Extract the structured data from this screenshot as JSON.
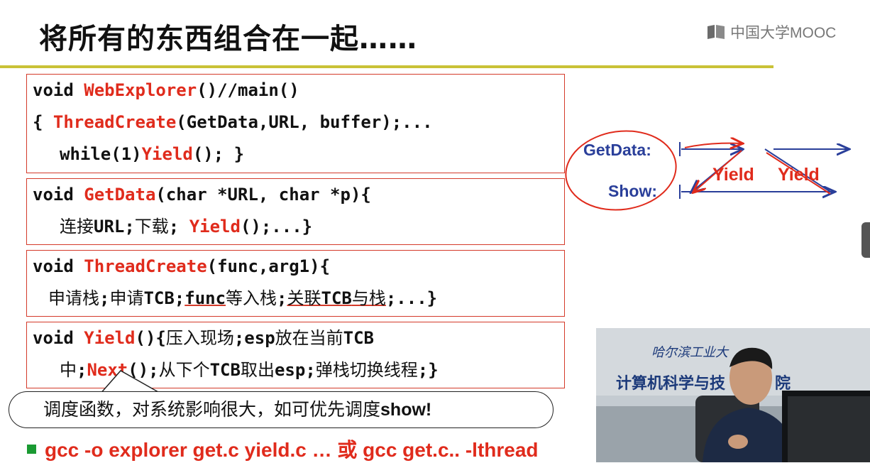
{
  "title": "将所有的东西组合在一起……",
  "mooc_logo": {
    "text": "中国大学MOOC",
    "icon": "book-icon"
  },
  "code": {
    "box1": {
      "l1_a": "void ",
      "l1_b": "WebExplorer",
      "l1_c": "()//main()",
      "l2_a": "{ ",
      "l2_b": "ThreadCreate",
      "l2_c": "(GetData,URL, buffer);...",
      "l3_a": "while(1)",
      "l3_b": "Yield",
      "l3_c": "(); }"
    },
    "box2": {
      "l1_a": "void ",
      "l1_b": "GetData",
      "l1_c": "(char *URL, char *p){",
      "l2_a": "连接",
      "l2_b": "URL;",
      "l2_c": "下载",
      "l2_d": "; ",
      "l2_e": "Yield",
      "l2_f": "();...}"
    },
    "box3": {
      "l1_a": "void ",
      "l1_b": "ThreadCreate",
      "l1_c": "(func,arg1){",
      "l2_a": "申请栈",
      "l2_b": ";",
      "l2_c": "申请",
      "l2_d": "TCB;",
      "l2_e": "func",
      "l2_f": "等入栈",
      "l2_g": ";",
      "l2_h": "关联",
      "l2_i": "TCB",
      "l2_j": "与栈",
      "l2_k": ";...}"
    },
    "box4": {
      "l1_a": "void ",
      "l1_b": "Yield",
      "l1_c": "(){",
      "l1_d": "压入现场",
      "l1_e": ";esp",
      "l1_f": "放在当前",
      "l1_g": "TCB",
      "l2_a": "中",
      "l2_b": ";",
      "l2_c": "Next",
      "l2_d": "();",
      "l2_e": "从下个",
      "l2_f": "TCB",
      "l2_g": "取出",
      "l2_h": "esp;",
      "l2_i": "弹栈切换线程",
      "l2_j": ";}"
    }
  },
  "callout": {
    "text": "调度函数，对系统影响很大，如可优先调度",
    "bold": "show!"
  },
  "bullet": {
    "text": "gcc -o explorer get.c yield.c … 或 gcc get.c.. -lthread",
    "color": "#e02b1c"
  },
  "diagram": {
    "getdata_label": "GetData:",
    "show_label": "Show:",
    "yield1": "Yield",
    "yield2": "Yield",
    "line_color": "#2a3f9a",
    "annotation_color": "#e02b1c"
  },
  "video": {
    "sign_text": "计算机科学与技",
    "sign_tail": "院",
    "school_text": "哈尔滨工业大"
  }
}
